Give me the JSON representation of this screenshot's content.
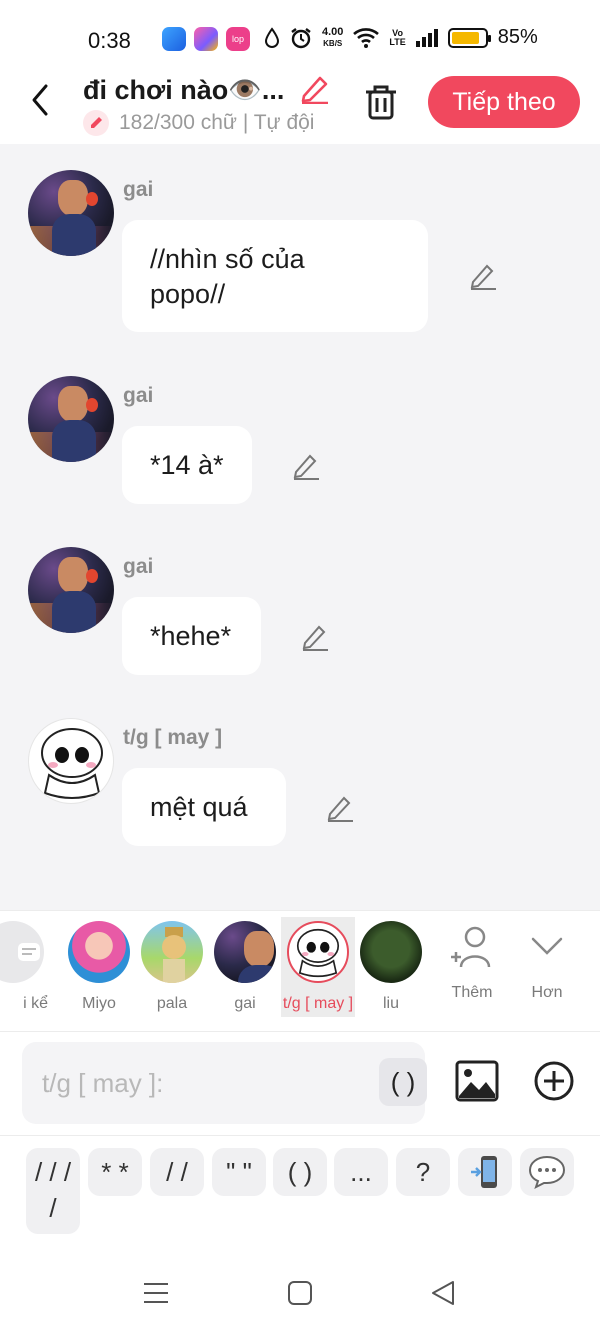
{
  "status": {
    "time": "0:38",
    "net_speed_value": "4.00",
    "net_speed_unit": "KB/S",
    "lte_top": "Vo",
    "lte_bottom": "LTE",
    "battery": "85%",
    "battery_level": 0.85,
    "apps": [
      "app-icon-1",
      "app-icon-2",
      "app-icon-3"
    ],
    "app3_label": "lop"
  },
  "header": {
    "title": "đi chơi nào👁️...",
    "subtitle": "182/300 chữ | Tự đội",
    "next_label": "Tiếp theo",
    "accent_color": "#f1485e"
  },
  "messages": [
    {
      "sender": "gai",
      "text_line1": "//nhìn số của",
      "text_line2": "popo//",
      "avatar": "gai"
    },
    {
      "sender": "gai",
      "text": "*14 à*",
      "avatar": "gai"
    },
    {
      "sender": "gai",
      "text": "*hehe*",
      "avatar": "gai"
    },
    {
      "sender": "t/g [ may ]",
      "text": "mệt quá",
      "avatar": "may"
    }
  ],
  "characters": [
    {
      "name": "i kể",
      "selected": false
    },
    {
      "name": "Miyo",
      "selected": false
    },
    {
      "name": "pala",
      "selected": false
    },
    {
      "name": "gai",
      "selected": false
    },
    {
      "name": "t/g [ may ]",
      "selected": true
    },
    {
      "name": "liu",
      "selected": false
    }
  ],
  "character_actions": {
    "add_label": "Thêm",
    "more_label": "Hơn"
  },
  "input": {
    "placeholder": "t/g [ may ]:",
    "paren_button": "( )"
  },
  "quick_symbols": [
    {
      "label_line1": "/ / /",
      "label_line2": "/"
    },
    {
      "label": "* *"
    },
    {
      "label": "/ /"
    },
    {
      "label": "\" \""
    },
    {
      "label": "( )"
    },
    {
      "label": "..."
    },
    {
      "label": "?"
    },
    {
      "icon": "phone-icon"
    },
    {
      "icon": "chat-bubble-icon"
    }
  ]
}
